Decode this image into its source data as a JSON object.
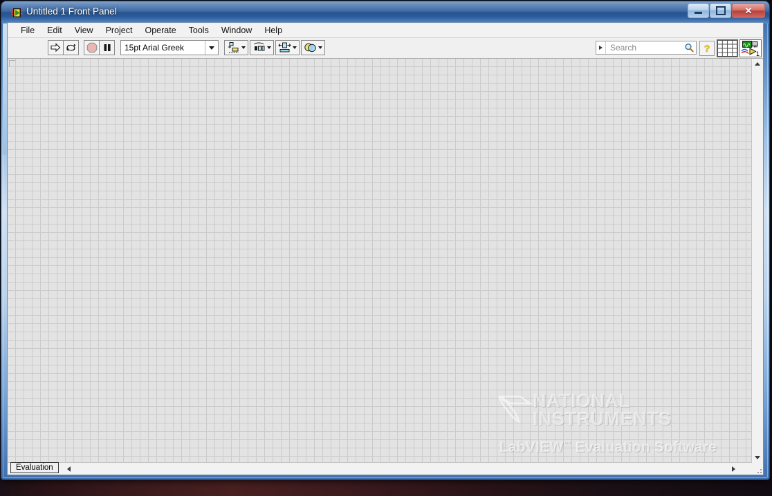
{
  "window": {
    "title": "Untitled 1 Front Panel",
    "app_icon": "labview-vi-icon",
    "controls": {
      "minimize": "minimize-button",
      "maximize": "maximize-button",
      "close_label": "✕"
    }
  },
  "menu": {
    "items": [
      {
        "label": "File"
      },
      {
        "label": "Edit"
      },
      {
        "label": "View"
      },
      {
        "label": "Project"
      },
      {
        "label": "Operate"
      },
      {
        "label": "Tools"
      },
      {
        "label": "Window"
      },
      {
        "label": "Help"
      }
    ]
  },
  "toolbar": {
    "run_button": "run-icon",
    "run_continuous_button": "run-continuously-icon",
    "abort_button": "abort-execution-icon",
    "pause_button": "pause-icon",
    "font": {
      "value": "15pt Arial Greek",
      "dropdown": "font-dropdown-caret"
    },
    "align_objects": "align-objects-icon",
    "distribute_objects": "distribute-objects-icon",
    "resize_objects": "resize-objects-icon",
    "reorder_objects": "reorder-objects-icon",
    "search": {
      "placeholder": "Search",
      "value": "",
      "magnifier": "search-magnifier-icon",
      "scope": "search-scope-arrow"
    },
    "context_help": "context-help-icon",
    "connector_pane": "connector-pane",
    "vi_icon": {
      "name": "vi-icon",
      "badge": "1"
    }
  },
  "panel": {
    "grid_size_px": 12,
    "background_color": "#e3e3e3",
    "grid_color": "#cbcbcb",
    "watermark": {
      "company_line1": "NATIONAL",
      "company_line2": "INSTRUMENTS",
      "product": "LabVIEW",
      "trademark": "™",
      "product_suffix": "Evaluation Software"
    }
  },
  "status": {
    "evaluation_label": "Evaluation"
  },
  "colors": {
    "title_bar": "#2f5f9e",
    "close_button": "#b8403a",
    "panel_bg": "#e3e3e3",
    "grid": "#cbcbcb",
    "toolbar_bg": "#f0f0f0"
  }
}
